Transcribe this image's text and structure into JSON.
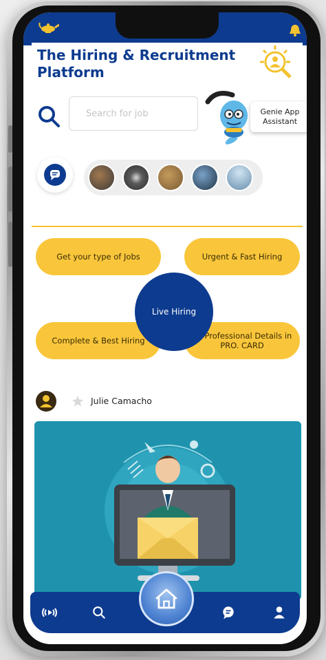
{
  "app": {
    "title": "The Hiring & Recruitment Platform"
  },
  "search": {
    "placeholder": "Search for job"
  },
  "genie": {
    "label": "Genie App Assistant"
  },
  "features": {
    "jobs": "Get your type of Jobs",
    "urgent": "Urgent & Fast Hiring",
    "live": "Live Hiring",
    "complete": "Complete & Best Hiring",
    "professional": "All Professional Details in PRO. CARD"
  },
  "post": {
    "username": "Julie Camacho"
  },
  "icons": {
    "top_left": "lamp-icon",
    "top_right": "bell-icon",
    "nav": [
      "live-broadcast-icon",
      "search-icon",
      "home-icon",
      "chat-icon",
      "profile-icon"
    ]
  },
  "colors": {
    "primary": "#0d3b8f",
    "accent": "#f9c63b",
    "image_bg": "#1f93ad"
  }
}
